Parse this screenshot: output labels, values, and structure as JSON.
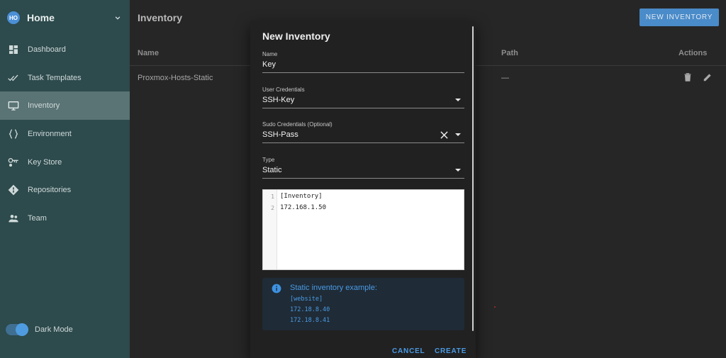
{
  "sidebar": {
    "avatar_text": "HO",
    "project_title": "Home",
    "items": [
      {
        "label": "Dashboard",
        "icon": "dashboard-icon"
      },
      {
        "label": "Task Templates",
        "icon": "checks-icon"
      },
      {
        "label": "Inventory",
        "icon": "monitor-icon",
        "active": true
      },
      {
        "label": "Environment",
        "icon": "braces-icon"
      },
      {
        "label": "Key Store",
        "icon": "key-icon"
      },
      {
        "label": "Repositories",
        "icon": "git-icon"
      },
      {
        "label": "Team",
        "icon": "people-icon"
      }
    ],
    "dark_mode_label": "Dark Mode",
    "dark_mode_on": true
  },
  "main": {
    "title": "Inventory",
    "new_button": "NEW INVENTORY",
    "columns": [
      "Name",
      "Path",
      "Actions"
    ],
    "rows": [
      {
        "name": "Proxmox-Hosts-Static",
        "path": "—"
      }
    ]
  },
  "dialog": {
    "title": "New Inventory",
    "name_label": "Name",
    "name_value": "Key",
    "user_cred_label": "User Credentials",
    "user_cred_value": "SSH-Key",
    "sudo_cred_label": "Sudo Credentials (Optional)",
    "sudo_cred_value": "SSH-Pass",
    "type_label": "Type",
    "type_value": "Static",
    "editor_lines": [
      {
        "num": "1",
        "text": "[Inventory]"
      },
      {
        "num": "2",
        "text": "172.168.1.50"
      }
    ],
    "info_title": "Static inventory example:",
    "info_lines": [
      "[website]",
      "172.18.8.40",
      "172.18.8.41"
    ],
    "cancel": "CANCEL",
    "create": "CREATE"
  },
  "colors": {
    "sidebar_bg": "#2d4a4c",
    "accent": "#4a9be6",
    "dialog_bg": "#212121"
  }
}
